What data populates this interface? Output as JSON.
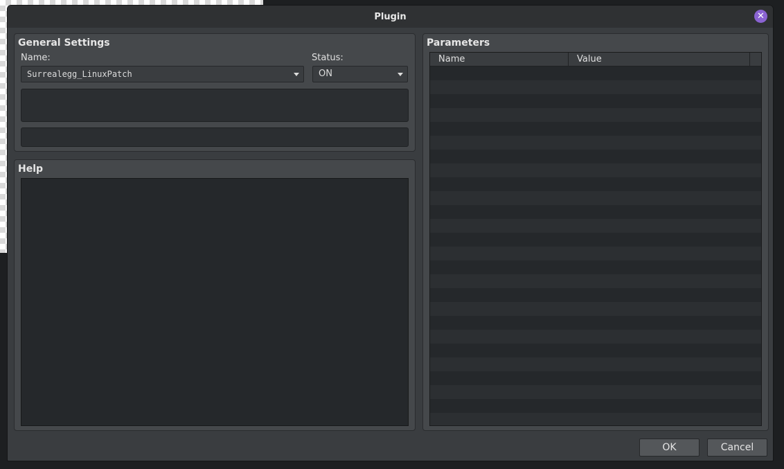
{
  "window": {
    "title": "Plugin"
  },
  "general": {
    "title": "General Settings",
    "name_label": "Name:",
    "name_value": "Surrealegg_LinuxPatch",
    "status_label": "Status:",
    "status_value": "ON"
  },
  "help": {
    "title": "Help"
  },
  "parameters": {
    "title": "Parameters",
    "columns": [
      "Name",
      "Value"
    ]
  },
  "footer": {
    "ok_label": "OK",
    "cancel_label": "Cancel"
  },
  "colors": {
    "accent_close": "#8a63d2"
  }
}
